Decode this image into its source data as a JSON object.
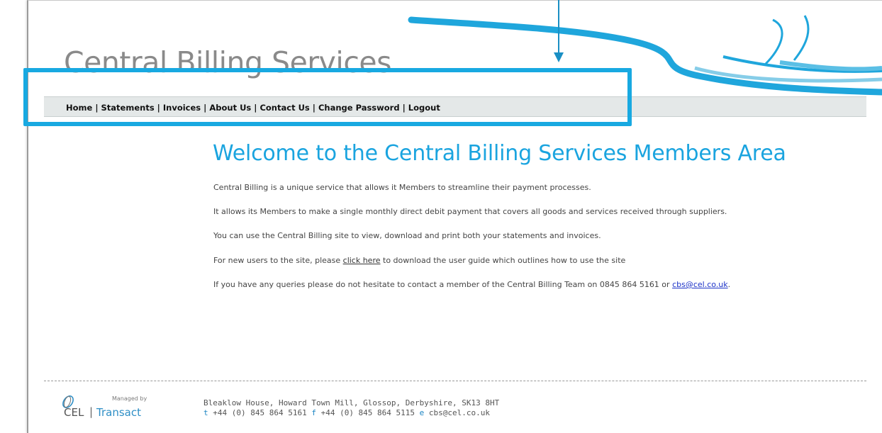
{
  "site": {
    "title": "Central Billing Services"
  },
  "nav": {
    "items": [
      {
        "label": "Home"
      },
      {
        "label": "Statements"
      },
      {
        "label": "Invoices"
      },
      {
        "label": "About Us"
      },
      {
        "label": "Contact Us"
      },
      {
        "label": "Change Password"
      },
      {
        "label": "Logout"
      }
    ],
    "separator": "|"
  },
  "main": {
    "heading": "Welcome to the Central Billing Services Members Area",
    "p1": "Central Billing is a unique service that allows it Members to streamline their payment processes.",
    "p2": "It allows its Members to make a single monthly direct debit payment that covers all goods and services received through suppliers.",
    "p3": "You can use the Central Billing site to view, download and print both your statements and invoices.",
    "p4_before": "For new users to the site, please ",
    "p4_link": "click here",
    "p4_after": " to download the user guide which outlines how to use the site",
    "p5_before": "If you have any queries please do not hesitate to contact a member of the Central Billing Team on 0845 864 5161 or ",
    "p5_link": "cbs@cel.co.uk",
    "p5_after": "."
  },
  "footer": {
    "logo_managed": "Managed by",
    "logo_cel": "CEL",
    "logo_pipe": "|",
    "logo_transact": "Transact",
    "address": "Bleaklow House, Howard Town Mill, Glossop, Derbyshire, SK13 8HT",
    "t_key": "t",
    "t_val": "+44 (0) 845 864 5161",
    "f_key": "f",
    "f_val": "+44 (0) 845 864 5115",
    "e_key": "e",
    "e_val": "cbs@cel.co.uk"
  },
  "colors": {
    "accent": "#18a9e1",
    "heading": "#1aa4df",
    "nav_bg": "#e4e8e8"
  }
}
